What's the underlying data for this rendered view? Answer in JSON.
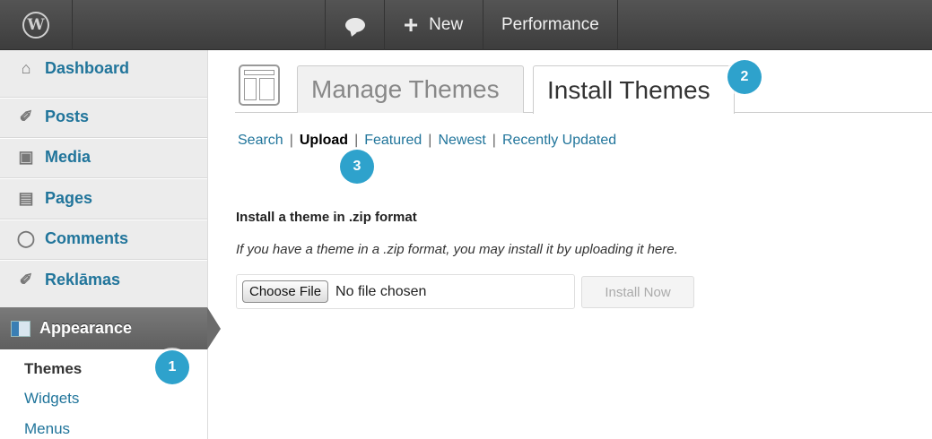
{
  "adminbar": {
    "wp_logo": "W",
    "new_label": "New",
    "new_icon": "+",
    "performance_label": "Performance"
  },
  "sidebar": {
    "items": [
      {
        "label": "Dashboard",
        "icon": "home-icon"
      },
      {
        "label": "Posts",
        "icon": "pushpin-icon"
      },
      {
        "label": "Media",
        "icon": "media-icon"
      },
      {
        "label": "Pages",
        "icon": "pages-icon"
      },
      {
        "label": "Comments",
        "icon": "comment-icon"
      },
      {
        "label": "Reklāmas",
        "icon": "pushpin-icon"
      }
    ],
    "active": {
      "label": "Appearance",
      "icon": "appearance-icon"
    },
    "submenu": [
      "Themes",
      "Widgets",
      "Menus"
    ]
  },
  "tabs": {
    "manage": "Manage Themes",
    "install": "Install Themes"
  },
  "subnav": {
    "search": "Search",
    "upload": "Upload",
    "featured": "Featured",
    "newest": "Newest",
    "recently_updated": "Recently Updated",
    "separator": "|"
  },
  "upload_form": {
    "heading": "Install a theme in .zip format",
    "description": "If you have a theme in a .zip format, you may install it by uploading it here.",
    "choose_file": "Choose File",
    "no_file": "No file chosen",
    "install_now": "Install Now"
  },
  "badges": [
    "1",
    "2",
    "3"
  ],
  "colors": {
    "link": "#21759b",
    "badge": "#2ea2cc",
    "adminbar": "#464646"
  }
}
